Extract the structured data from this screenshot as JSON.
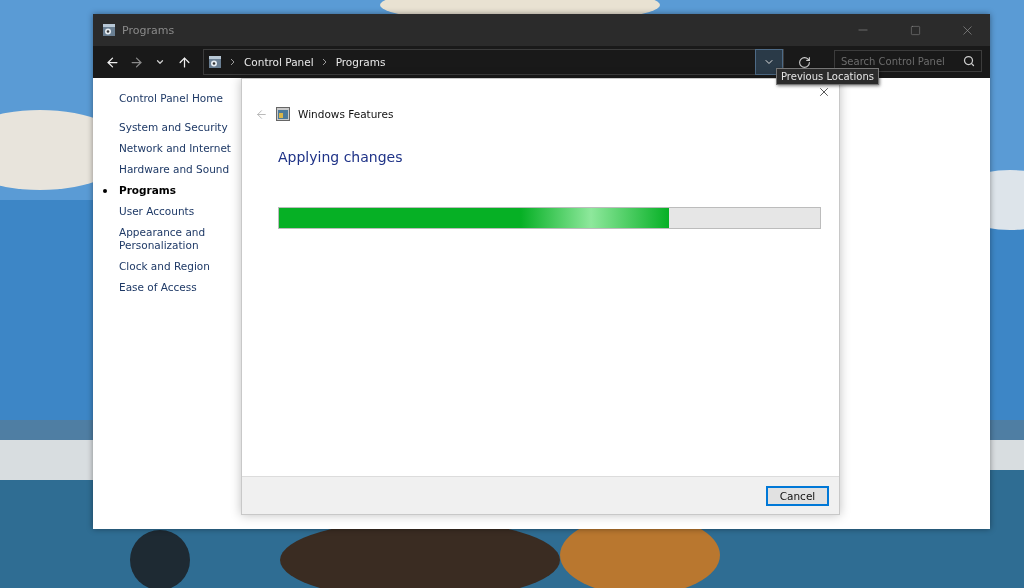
{
  "window": {
    "title": "Programs"
  },
  "address_bar": {
    "breadcrumbs": [
      "Control Panel",
      "Programs"
    ]
  },
  "search": {
    "placeholder": "Search Control Panel"
  },
  "tooltip": "Previous Locations",
  "sidebar": {
    "home": "Control Panel Home",
    "items": [
      {
        "label": "System and Security",
        "selected": false
      },
      {
        "label": "Network and Internet",
        "selected": false
      },
      {
        "label": "Hardware and Sound",
        "selected": false
      },
      {
        "label": "Programs",
        "selected": true
      },
      {
        "label": "User Accounts",
        "selected": false
      },
      {
        "label": "Appearance and Personalization",
        "selected": false
      },
      {
        "label": "Clock and Region",
        "selected": false
      },
      {
        "label": "Ease of Access",
        "selected": false
      }
    ]
  },
  "dialog": {
    "title": "Windows Features",
    "heading": "Applying changes",
    "progress": {
      "level": 0.72
    },
    "buttons": [
      "Cancel"
    ]
  }
}
